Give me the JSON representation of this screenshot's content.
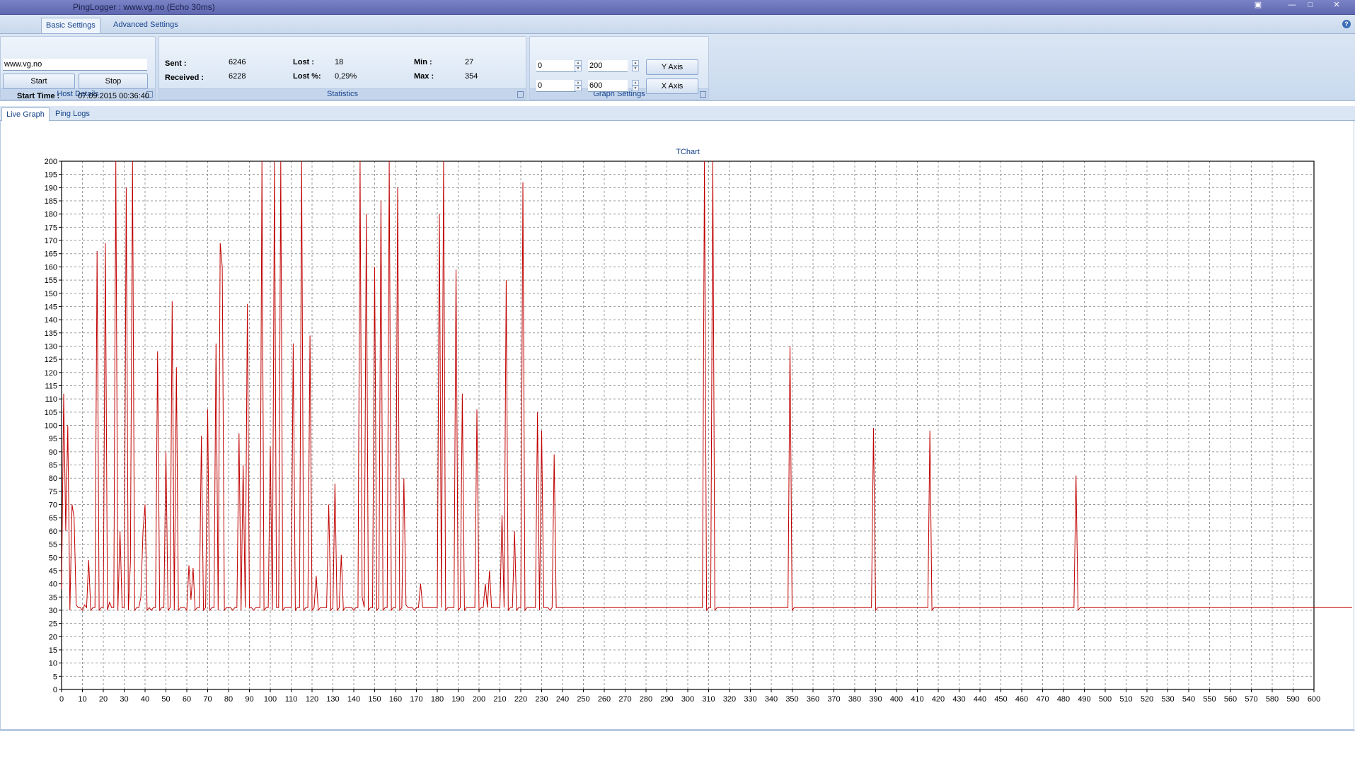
{
  "window": {
    "title": "PingLogger : www.vg.no (Echo 30ms)",
    "buttons": [
      "restore-icon",
      "minimize-icon",
      "maximize-icon",
      "close-icon"
    ]
  },
  "ribbon": {
    "tabs": [
      {
        "label": "Basic Settings",
        "active": true
      },
      {
        "label": "Advanced Settings",
        "active": false
      }
    ],
    "help_label": "?"
  },
  "host_details": {
    "host": "www.vg.no",
    "start_label": "Start",
    "stop_label": "Stop",
    "start_time_label": "Start Time :",
    "start_time_value": "07.09.2015 00:36:40",
    "caption": "Host Details"
  },
  "statistics": {
    "sent_label": "Sent :",
    "sent_value": "6246",
    "received_label": "Received :",
    "received_value": "6228",
    "lost_label": "Lost :",
    "lost_value": "18",
    "lost_pct_label": "Lost %:",
    "lost_pct_value": "0,29%",
    "min_label": "Min :",
    "min_value": "27",
    "max_label": "Max :",
    "max_value": "354",
    "caption": "Statistics"
  },
  "graph_settings": {
    "y_min": "0",
    "y_max": "200",
    "x_min": "0",
    "x_max": "600",
    "y_axis_label": "Y Axis",
    "x_axis_label": "X Axis",
    "caption": "Graph Settings"
  },
  "doc_tabs": [
    {
      "label": "Live Graph",
      "active": true
    },
    {
      "label": "Ping Logs",
      "active": false
    }
  ],
  "colors": {
    "series": "#c00000",
    "accent": "#15428b"
  },
  "chart_data": {
    "type": "line",
    "title": "TChart",
    "xlim": [
      0,
      600
    ],
    "ylim": [
      0,
      200
    ],
    "x_step": 10,
    "y_step": 5,
    "grid": true,
    "series": [
      {
        "x_start": 0,
        "x_interval": 1,
        "values": [
          38,
          112,
          60,
          100,
          30,
          70,
          65,
          32,
          31,
          31,
          30,
          32,
          31,
          49,
          30,
          31,
          31,
          166,
          30,
          31,
          31,
          169,
          30,
          33,
          31,
          31,
          200,
          30,
          60,
          31,
          31,
          190,
          30,
          48,
          200,
          30,
          31,
          31,
          35,
          60,
          70,
          30,
          31,
          30,
          31,
          31,
          128,
          30,
          31,
          31,
          90,
          30,
          31,
          147,
          30,
          122,
          30,
          31,
          31,
          31,
          30,
          47,
          34,
          46,
          30,
          31,
          31,
          96,
          30,
          31,
          106,
          30,
          31,
          31,
          131,
          30,
          169,
          160,
          30,
          31,
          31,
          31,
          30,
          31,
          31,
          97,
          30,
          85,
          31,
          146,
          31,
          31,
          30,
          31,
          31,
          31,
          200,
          30,
          31,
          31,
          92,
          30,
          200,
          31,
          31,
          200,
          30,
          31,
          31,
          31,
          31,
          131,
          30,
          31,
          31,
          200,
          30,
          31,
          31,
          134,
          30,
          31,
          43,
          30,
          31,
          31,
          31,
          31,
          70,
          30,
          31,
          78,
          30,
          31,
          51,
          30,
          31,
          31,
          31,
          31,
          30,
          31,
          31,
          200,
          35,
          31,
          180,
          30,
          31,
          31,
          160,
          30,
          31,
          185,
          30,
          31,
          31,
          200,
          30,
          31,
          31,
          190,
          30,
          31,
          80,
          32,
          31,
          31,
          31,
          30,
          31,
          31,
          40,
          31,
          31,
          31,
          31,
          31,
          31,
          31,
          31,
          180,
          31,
          200,
          30,
          31,
          31,
          31,
          31,
          159,
          30,
          31,
          112,
          30,
          31,
          31,
          31,
          31,
          31,
          106,
          30,
          31,
          31,
          40,
          31,
          45,
          31,
          31,
          31,
          31,
          31,
          66,
          31,
          155,
          30,
          31,
          31,
          60,
          30,
          31,
          31,
          192,
          30,
          31,
          31,
          31,
          31,
          31,
          105,
          30,
          98,
          31,
          31,
          31,
          30,
          31,
          89,
          31,
          31,
          31,
          31,
          31,
          31,
          31,
          31,
          31,
          31,
          31,
          31,
          31,
          31,
          31,
          31,
          31,
          31,
          31,
          31,
          31,
          31,
          31,
          31,
          31,
          31,
          31,
          31,
          31,
          31,
          31,
          31,
          31,
          31,
          31,
          31,
          31,
          31,
          31,
          31,
          31,
          31,
          31,
          31,
          31,
          31,
          31,
          31,
          31,
          31,
          31,
          31,
          31,
          31,
          31,
          31,
          31,
          31,
          31,
          31,
          31,
          31,
          31,
          31,
          31,
          31,
          31,
          31,
          31,
          31,
          31,
          200,
          30,
          31,
          31,
          200,
          30,
          31,
          31,
          31,
          31,
          31,
          31,
          31,
          31,
          31,
          31,
          31,
          31,
          31,
          31,
          31,
          31,
          31,
          31,
          31,
          31,
          31,
          31,
          31,
          31,
          31,
          31,
          31,
          31,
          31,
          31,
          31,
          31,
          31,
          31,
          31,
          130,
          30,
          31,
          31,
          31,
          31,
          31,
          31,
          31,
          31,
          31,
          31,
          31,
          31,
          31,
          31,
          31,
          31,
          31,
          31,
          31,
          31,
          31,
          31,
          31,
          31,
          31,
          31,
          31,
          31,
          31,
          31,
          31,
          31,
          31,
          31,
          31,
          31,
          31,
          31,
          99,
          30,
          31,
          31,
          31,
          31,
          31,
          31,
          31,
          31,
          31,
          31,
          31,
          31,
          31,
          31,
          31,
          31,
          31,
          31,
          31,
          31,
          31,
          31,
          31,
          31,
          31,
          98,
          30,
          31,
          31,
          31,
          31,
          31,
          31,
          31,
          31,
          31,
          31,
          31,
          31,
          31,
          31,
          31,
          31,
          31,
          31,
          31,
          31,
          31,
          31,
          31,
          31,
          31,
          31,
          31,
          31,
          31,
          31,
          31,
          31,
          31,
          31,
          31,
          31,
          31,
          31,
          31,
          31,
          31,
          31,
          31,
          31,
          31,
          31,
          31,
          31,
          31,
          31,
          31,
          31,
          31,
          31,
          31,
          31,
          31,
          31,
          31,
          31,
          31,
          31,
          31,
          31,
          31,
          31,
          31,
          31,
          81,
          30,
          31,
          31,
          31,
          31,
          31,
          31,
          31,
          31,
          31,
          31,
          31,
          31,
          31,
          31,
          31,
          31,
          31,
          31,
          31,
          31,
          31,
          31,
          31,
          31,
          31,
          31,
          31,
          31,
          31,
          31,
          31,
          31,
          31,
          31,
          31,
          31,
          31,
          31,
          31,
          31,
          31,
          31,
          31,
          31,
          31,
          31,
          31,
          31,
          31,
          31,
          31,
          31,
          31,
          31,
          31,
          31,
          31,
          31,
          31,
          31,
          31,
          31,
          31,
          31,
          31,
          31,
          31,
          31,
          31,
          31,
          31,
          31,
          31,
          31,
          31,
          31,
          31,
          31,
          31,
          31,
          31,
          31,
          31,
          31,
          31,
          31,
          31,
          31,
          31,
          31,
          31,
          31,
          31,
          31,
          31,
          31,
          31,
          31,
          31,
          31,
          31,
          31,
          31,
          31,
          31,
          31,
          31,
          31,
          31,
          31,
          31,
          31,
          31,
          31,
          31,
          31,
          31,
          31,
          31,
          31,
          31,
          31,
          31,
          31,
          31,
          31,
          31,
          31,
          31,
          31,
          31,
          31,
          31,
          31,
          31,
          31,
          31,
          31,
          31,
          31,
          31,
          31,
          31,
          31
        ]
      }
    ]
  }
}
